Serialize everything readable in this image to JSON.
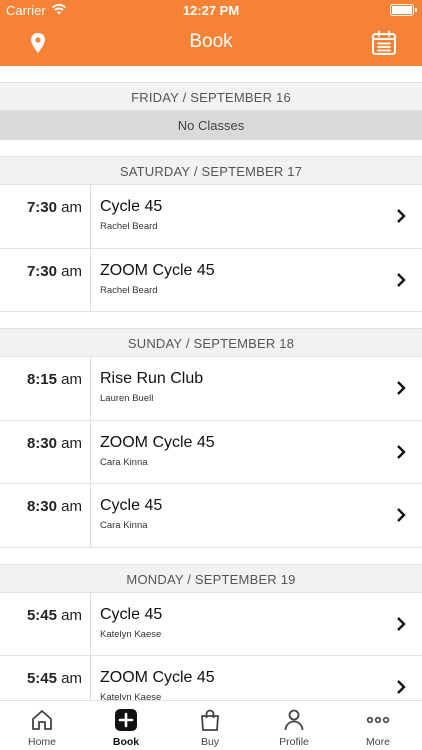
{
  "status_bar": {
    "carrier": "Carrier",
    "time": "12:27 PM"
  },
  "nav": {
    "title": "Book",
    "left_icon": "location-pin-icon",
    "right_icon": "calendar-list-icon"
  },
  "days": [
    {
      "header": "FRIDAY / SEPTEMBER 16",
      "empty_text": "No Classes",
      "classes": []
    },
    {
      "header": "SATURDAY / SEPTEMBER 17",
      "classes": [
        {
          "time": "7:30",
          "ampm": "am",
          "name": "Cycle 45",
          "instructor": "Rachel Beard"
        },
        {
          "time": "7:30",
          "ampm": "am",
          "name": "ZOOM Cycle 45",
          "instructor": "Rachel Beard"
        }
      ]
    },
    {
      "header": "SUNDAY / SEPTEMBER 18",
      "classes": [
        {
          "time": "8:15",
          "ampm": "am",
          "name": "Rise Run Club",
          "instructor": "Lauren Buell"
        },
        {
          "time": "8:30",
          "ampm": "am",
          "name": "ZOOM Cycle 45",
          "instructor": "Cara Kinna"
        },
        {
          "time": "8:30",
          "ampm": "am",
          "name": "Cycle 45",
          "instructor": "Cara Kinna"
        }
      ]
    },
    {
      "header": "MONDAY / SEPTEMBER 19",
      "classes": [
        {
          "time": "5:45",
          "ampm": "am",
          "name": "Cycle 45",
          "instructor": "Katelyn Kaese"
        },
        {
          "time": "5:45",
          "ampm": "am",
          "name": "ZOOM Cycle 45",
          "instructor": "Katelyn Kaese"
        }
      ]
    }
  ],
  "tabs": [
    {
      "label": "Home",
      "icon": "home-icon"
    },
    {
      "label": "Book",
      "icon": "book-plus-icon",
      "active": true
    },
    {
      "label": "Buy",
      "icon": "shopping-bag-icon"
    },
    {
      "label": "Profile",
      "icon": "profile-icon"
    },
    {
      "label": "More",
      "icon": "more-dots-icon"
    }
  ],
  "colors": {
    "accent": "#f58235",
    "header_bg": "#f2f2f2",
    "no_classes_bg": "#d9d9d9"
  }
}
